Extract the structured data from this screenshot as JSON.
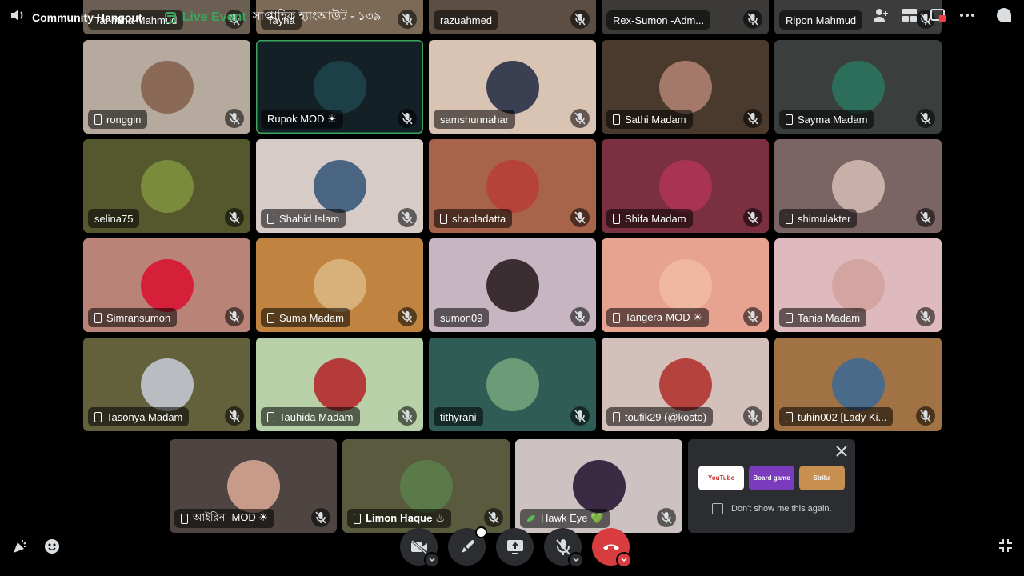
{
  "channel": {
    "title": "Community Hangout"
  },
  "event": {
    "live_label": "Live Event",
    "name": "সাপ্তাহিক হ্যাংআউট - ১৩৯"
  },
  "colors": {
    "live": "#3ba55d",
    "speaking_border": "#3ba55d",
    "hangup": "#d83c3e"
  },
  "participants_top_partial": [
    {
      "name": "Tahmina Mahmud",
      "bg": "#6b5e52"
    },
    {
      "name": "Tayna",
      "bg": "#7c6a56"
    },
    {
      "name": "razuahmed",
      "bg": "#5d4e44"
    },
    {
      "name": "Rex-Sumon -Adm...",
      "bg": "#3b3a39"
    },
    {
      "name": "Ripon Mahmud",
      "bg": "#3d3c3c"
    }
  ],
  "participants": [
    {
      "name": "ronggin",
      "bg": "#b6a99e",
      "avatar": "#8a6a56",
      "device": true
    },
    {
      "name": "Rupok MOD ☀",
      "bg": "#132126",
      "avatar": "#1d4048",
      "device": false,
      "speaking": true
    },
    {
      "name": "samshunnahar",
      "bg": "#d9c4b4",
      "avatar": "#3a3f52",
      "device": false
    },
    {
      "name": "Sathi Madam",
      "bg": "#4a3a2e",
      "avatar": "#a5796a",
      "device": true
    },
    {
      "name": "Sayma Madam",
      "bg": "#3a3f3e",
      "avatar": "#2d6e5b",
      "device": true
    },
    {
      "name": "selina75",
      "bg": "#55572d",
      "avatar": "#7a8b3c",
      "device": false
    },
    {
      "name": "Shahid Islam",
      "bg": "#d6cbc7",
      "avatar": "#4a6582",
      "device": true
    },
    {
      "name": "shapladatta",
      "bg": "#a8644a",
      "avatar": "#b5433a",
      "device": true
    },
    {
      "name": "Shifa Madam",
      "bg": "#7a3040",
      "avatar": "#a83355",
      "device": true
    },
    {
      "name": "shimulakter",
      "bg": "#7a6464",
      "avatar": "#c8b0a8",
      "device": true
    },
    {
      "name": "Simransumon",
      "bg": "#b98378",
      "avatar": "#d6203a",
      "device": true
    },
    {
      "name": "Suma Madam",
      "bg": "#c08440",
      "avatar": "#d8b07a",
      "device": true
    },
    {
      "name": "sumon09",
      "bg": "#c7b5c2",
      "avatar": "#3a2e32",
      "device": false
    },
    {
      "name": "Tangera-MOD ☀",
      "bg": "#e8a290",
      "avatar": "#f0b8a0",
      "device": true
    },
    {
      "name": "Tania Madam",
      "bg": "#deb9bd",
      "avatar": "#d4a5a0",
      "device": true
    },
    {
      "name": "Tasonya Madam",
      "bg": "#62613c",
      "avatar": "#b9bcc0",
      "device": true
    },
    {
      "name": "Tauhida Madam",
      "bg": "#b7d0a7",
      "avatar": "#b53a3a",
      "device": true
    },
    {
      "name": "tithyrani",
      "bg": "#2f5d55",
      "avatar": "#6c9b78",
      "device": false
    },
    {
      "name": "toufik29 (@kosto)",
      "bg": "#d4c0ba",
      "avatar": "#b5423c",
      "device": true
    },
    {
      "name": "tuhin002 [Lady Ki...",
      "bg": "#a07244",
      "avatar": "#4a6a8a",
      "device": true
    }
  ],
  "participants_bottom": [
    {
      "name": "আইরিন -MOD ☀",
      "bg": "#4e4542",
      "avatar": "#c89a8a",
      "device": true
    },
    {
      "name": "𝐋𝐢𝐦𝐨𝐧 𝐇𝐚𝐪𝐮𝐞 ♨",
      "bg": "#5a5a3e",
      "avatar": "#5a7a4a",
      "device": true
    },
    {
      "name": "Hawk Eye 💚",
      "bg": "#ccc2c2",
      "avatar": "#3a2a44",
      "device": false,
      "leaf": true
    }
  ],
  "promo": {
    "cards": [
      {
        "label": "YouTube",
        "color": "#ffffff"
      },
      {
        "label": "Board game",
        "color": "#7a3bbf"
      },
      {
        "label": "Strike",
        "color": "#c89050"
      }
    ],
    "checkbox_label": "Don't show me this again."
  }
}
